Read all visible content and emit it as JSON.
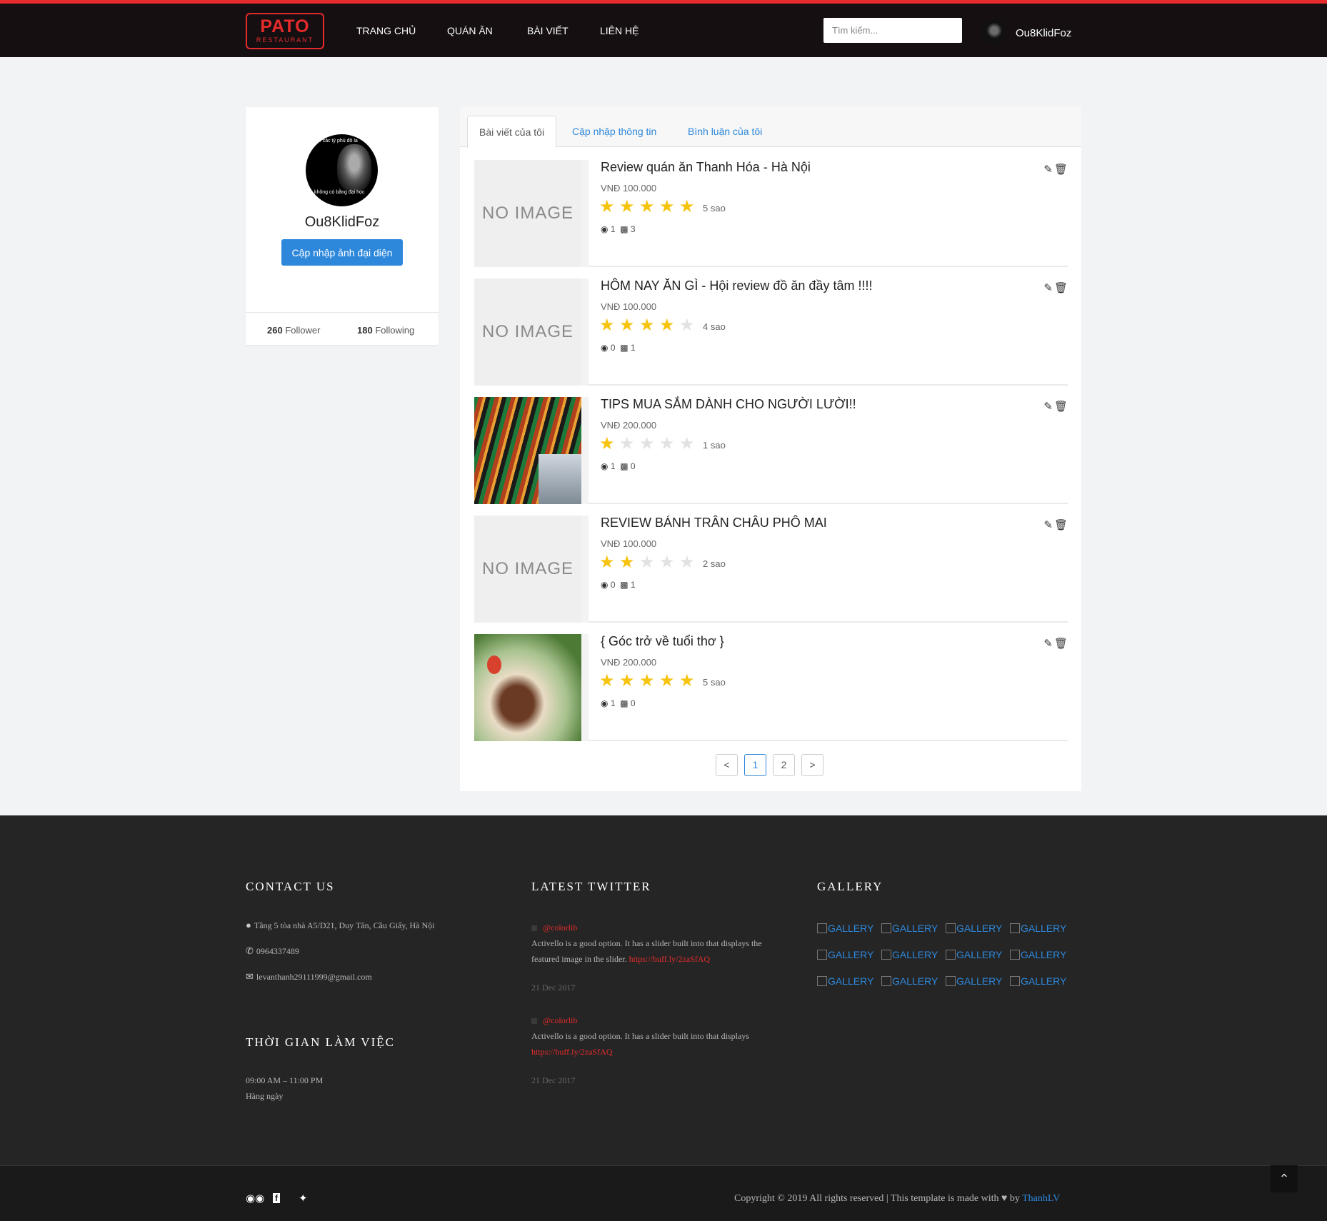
{
  "header": {
    "logo_main": "PATO",
    "logo_sub": "RESTAURANT",
    "nav": [
      "TRANG CHỦ",
      "QUÁN ĂN",
      "BÀI VIẾT",
      "LIÊN HỆ"
    ],
    "search_placeholder": "Tìm kiếm...",
    "username": "Ou8KlidFoz"
  },
  "profile": {
    "avatar_text_top": "... các tỷ phú đô la",
    "avatar_text_bottom": "không có bằng đại học",
    "name": "Ou8KlidFoz",
    "update_avatar_label": "Cập nhập ảnh đại diện",
    "followers": "260",
    "followers_label": "Follower",
    "following": "180",
    "following_label": "Following"
  },
  "tabs": [
    "Bài viết của tôi",
    "Cập nhập thông tin",
    "Bình luận của tôi"
  ],
  "posts": [
    {
      "title": "Review quán ăn Thanh Hóa - Hà Nội",
      "price": "VNĐ 100.000",
      "rating": 5,
      "rating_label": "5 sao",
      "views": "1",
      "comments": "3",
      "image": "NO IMAGE"
    },
    {
      "title": "HÔM NAY ĂN GÌ - Hội review đồ ăn đầy tâm !!!!",
      "price": "VNĐ 100.000",
      "rating": 4,
      "rating_label": "4 sao",
      "views": "0",
      "comments": "1",
      "image": "NO IMAGE"
    },
    {
      "title": "TIPS MUA SẮM DÀNH CHO NGƯỜI LƯỜI!!",
      "price": "VNĐ 200.000",
      "rating": 1,
      "rating_label": "1 sao",
      "views": "1",
      "comments": "0",
      "image": ""
    },
    {
      "title": "REVIEW BÁNH TRÂN CHÂU PHÔ MAI",
      "price": "VNĐ 100.000",
      "rating": 2,
      "rating_label": "2 sao",
      "views": "0",
      "comments": "1",
      "image": "NO IMAGE"
    },
    {
      "title": "{ Góc trở về tuổi thơ }",
      "price": "VNĐ 200.000",
      "rating": 5,
      "rating_label": "5 sao",
      "views": "1",
      "comments": "0",
      "image": ""
    }
  ],
  "pagination": {
    "prev": "<",
    "pages": [
      "1",
      "2"
    ],
    "next": ">",
    "current": "1"
  },
  "footer": {
    "contact_heading": "CONTACT US",
    "address": "Tầng 5 tòa nhà A5/D21, Duy Tân, Cầu Giấy, Hà Nội",
    "phone": "0964337489",
    "email": "levanthanh29111999@gmail.com",
    "hours_heading": "THỜI GIAN LÀM VIỆC",
    "hours": "09:00 AM – 11:00 PM",
    "days": "Hàng ngày",
    "twitter_heading": "LATEST TWITTER",
    "tweets": [
      {
        "handle": "@colorlib",
        "line1": "Activello is a good option. It has a slider built into that displays the",
        "line2": "featured image in the slider.",
        "link": "https://buff.ly/2zaSfAQ",
        "date": "21 Dec 2017"
      },
      {
        "handle": "@colorlib",
        "line1": "Activello is a good option. It has a slider built into that displays",
        "line2": "",
        "link": "https://buff.ly/2zaSfAQ",
        "date": "21 Dec 2017"
      }
    ],
    "gallery_heading": "GALLERY",
    "gallery_alt": "GALLERY",
    "copyright": "Copyright © 2019 All rights reserved | This template is made with",
    "copyright_by_word": "by",
    "copyright_author": "ThanhLV"
  },
  "colors": {
    "accent": "#e52b2b",
    "link": "#2d88db",
    "star": "#f6c30e",
    "header_bg": "#150f12",
    "footer_bg": "#252525"
  },
  "icons": [
    "map-marker-icon",
    "phone-icon",
    "envelope-icon",
    "eye-icon",
    "comment-icon",
    "edit-icon",
    "trash-icon",
    "tripadvisor-icon",
    "facebook-icon",
    "twitter-icon",
    "arrow-up-icon",
    "heart-icon"
  ]
}
